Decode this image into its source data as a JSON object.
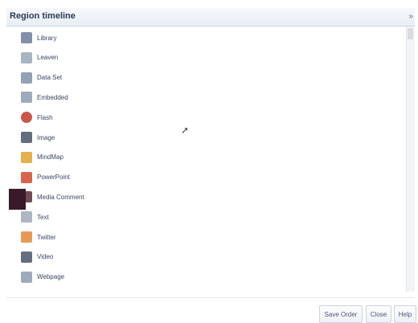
{
  "dialog": {
    "title": "Region timeline",
    "close_icon": "close-icon"
  },
  "items": [
    {
      "label": "Library",
      "icon": "library-icon",
      "color": "#6b7d99"
    },
    {
      "label": "Leaven",
      "icon": "leaven-icon",
      "color": "#9aa7b8"
    },
    {
      "label": "Data Set",
      "icon": "data-set-icon",
      "color": "#7f90a8"
    },
    {
      "label": "Embedded",
      "icon": "embedded-icon",
      "color": "#8e9bb0"
    },
    {
      "label": "Flash",
      "icon": "flash-icon",
      "color": "#c0392b"
    },
    {
      "label": "Image",
      "icon": "image-icon",
      "color": "#4a5568"
    },
    {
      "label": "MindMap",
      "icon": "mindmap-icon",
      "color": "#e0a030"
    },
    {
      "label": "PowerPoint",
      "icon": "powerpoint-icon",
      "color": "#d04a2e"
    },
    {
      "label": "Media Comment",
      "icon": "media-comment-icon",
      "color": "#5a2a3a"
    },
    {
      "label": "Text",
      "icon": "text-icon",
      "color": "#a0a8b8"
    },
    {
      "label": "Twitter",
      "icon": "twitter-icon",
      "color": "#e08a3a"
    },
    {
      "label": "Video",
      "icon": "video-icon",
      "color": "#4a5568"
    },
    {
      "label": "Webpage",
      "icon": "webpage-icon",
      "color": "#8e9bb0"
    }
  ],
  "footer": {
    "save_order": "Save Order",
    "close": "Close",
    "help": "Help"
  }
}
